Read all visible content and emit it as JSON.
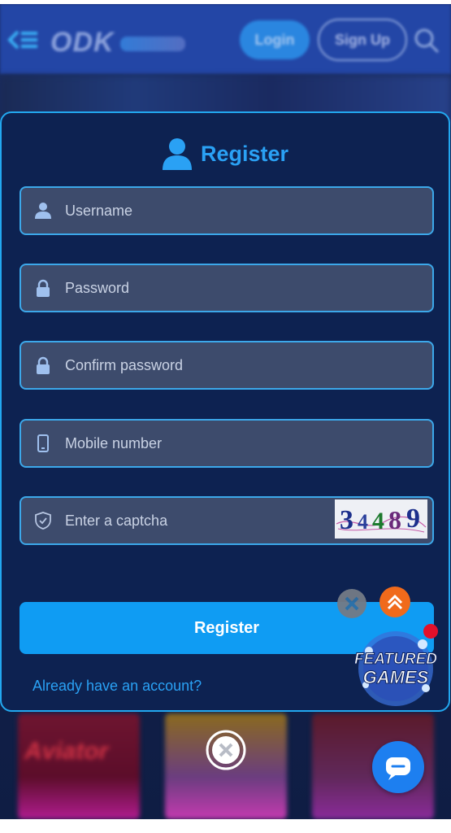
{
  "background": {
    "logo_text": "ODK",
    "login_label": "Login",
    "signup_label": "Sign Up",
    "game_tile_label": "Aviator"
  },
  "modal": {
    "title": "Register",
    "fields": {
      "username": {
        "placeholder": "Username",
        "icon": "user-icon"
      },
      "password": {
        "placeholder": "Password",
        "icon": "lock-icon"
      },
      "confirm_password": {
        "placeholder": "Confirm password",
        "icon": "lock-icon"
      },
      "mobile": {
        "placeholder": "Mobile number",
        "icon": "phone-icon"
      },
      "captcha": {
        "placeholder": "Enter a captcha",
        "icon": "shield-check-icon",
        "code": "34489"
      }
    },
    "register_label": "Register",
    "account_link": "Already have an account?"
  },
  "floating": {
    "featured_line1": "FEATURED",
    "featured_line2": "GAMES"
  },
  "colors": {
    "modal_bg": "#0d2251",
    "accent": "#2aa1f4",
    "button": "#0f9cf3",
    "field_bg": "#3d4b6c",
    "orange": "#f06a1b",
    "chat": "#1d7ff0"
  }
}
